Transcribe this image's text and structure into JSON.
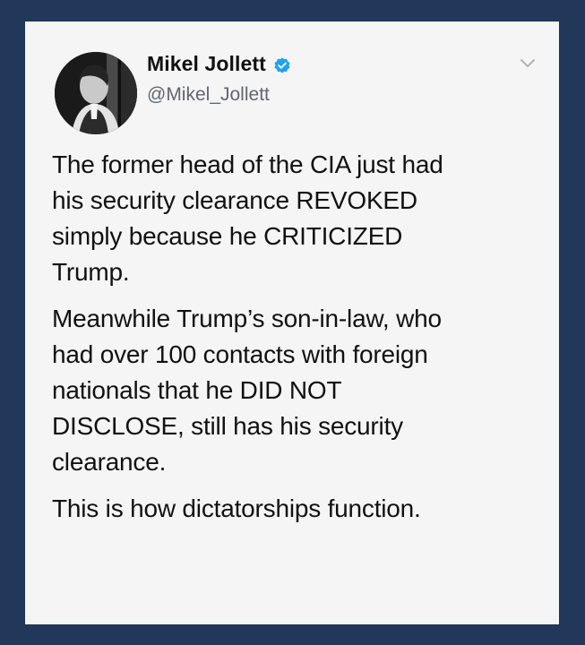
{
  "tweet": {
    "author": {
      "display_name": "Mikel Jollett",
      "handle": "@Mikel_Jollett",
      "verified_icon": "verified-badge-icon",
      "avatar_icon": "profile-avatar-icon"
    },
    "menu_icon": "chevron-down-icon",
    "body": [
      "The former head of the CIA just had\nhis security clearance REVOKED\nsimply because he CRITICIZED\nTrump.",
      "Meanwhile Trump’s son-in-law, who\nhad over 100 contacts with foreign\nnationals that he DID NOT\nDISCLOSE, still has his security\nclearance.",
      "This is how dictatorships function."
    ]
  },
  "colors": {
    "frame_background": "#21385a",
    "card_background": "#f5f5f5",
    "text": "#111111",
    "handle": "#5f6870",
    "verified": "#1da1f2"
  }
}
